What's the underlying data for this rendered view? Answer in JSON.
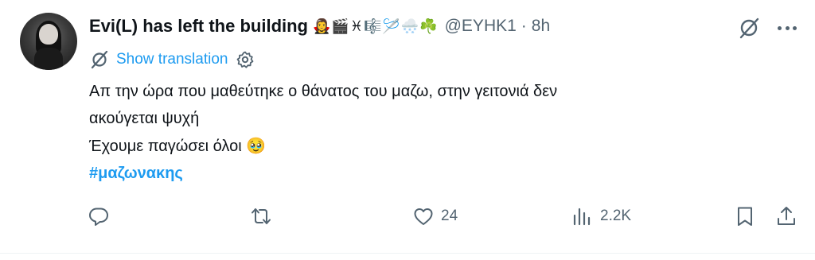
{
  "author": {
    "display_name": "Evi(L) has left the building",
    "name_emojis": "🧛‍♀️🎬♓🎼🪡🌨️☘️",
    "handle": "@EYHK1",
    "separator": "·",
    "time": "8h"
  },
  "translate": {
    "label": "Show translation"
  },
  "post": {
    "line1": "Απ την ώρα που μαθεύτηκε ο θάνατος του μαζω, στην γειτονιά δεν",
    "line2": "ακούγεται ψυχή",
    "line3": "Έχουμε παγώσει όλοι",
    "line3_emoji": "🥹",
    "hashtag": "#μαζωνακης"
  },
  "actions": {
    "likes": "24",
    "views": "2.2K"
  },
  "colors": {
    "text": "#0f1419",
    "secondary": "#536471",
    "accent": "#1d9bf0",
    "divider": "#eff3f4"
  },
  "icons": [
    "grok-icon",
    "more-icon",
    "translate-icon",
    "gear-icon",
    "reply-icon",
    "repost-icon",
    "like-icon",
    "views-icon",
    "bookmark-icon",
    "share-icon"
  ]
}
